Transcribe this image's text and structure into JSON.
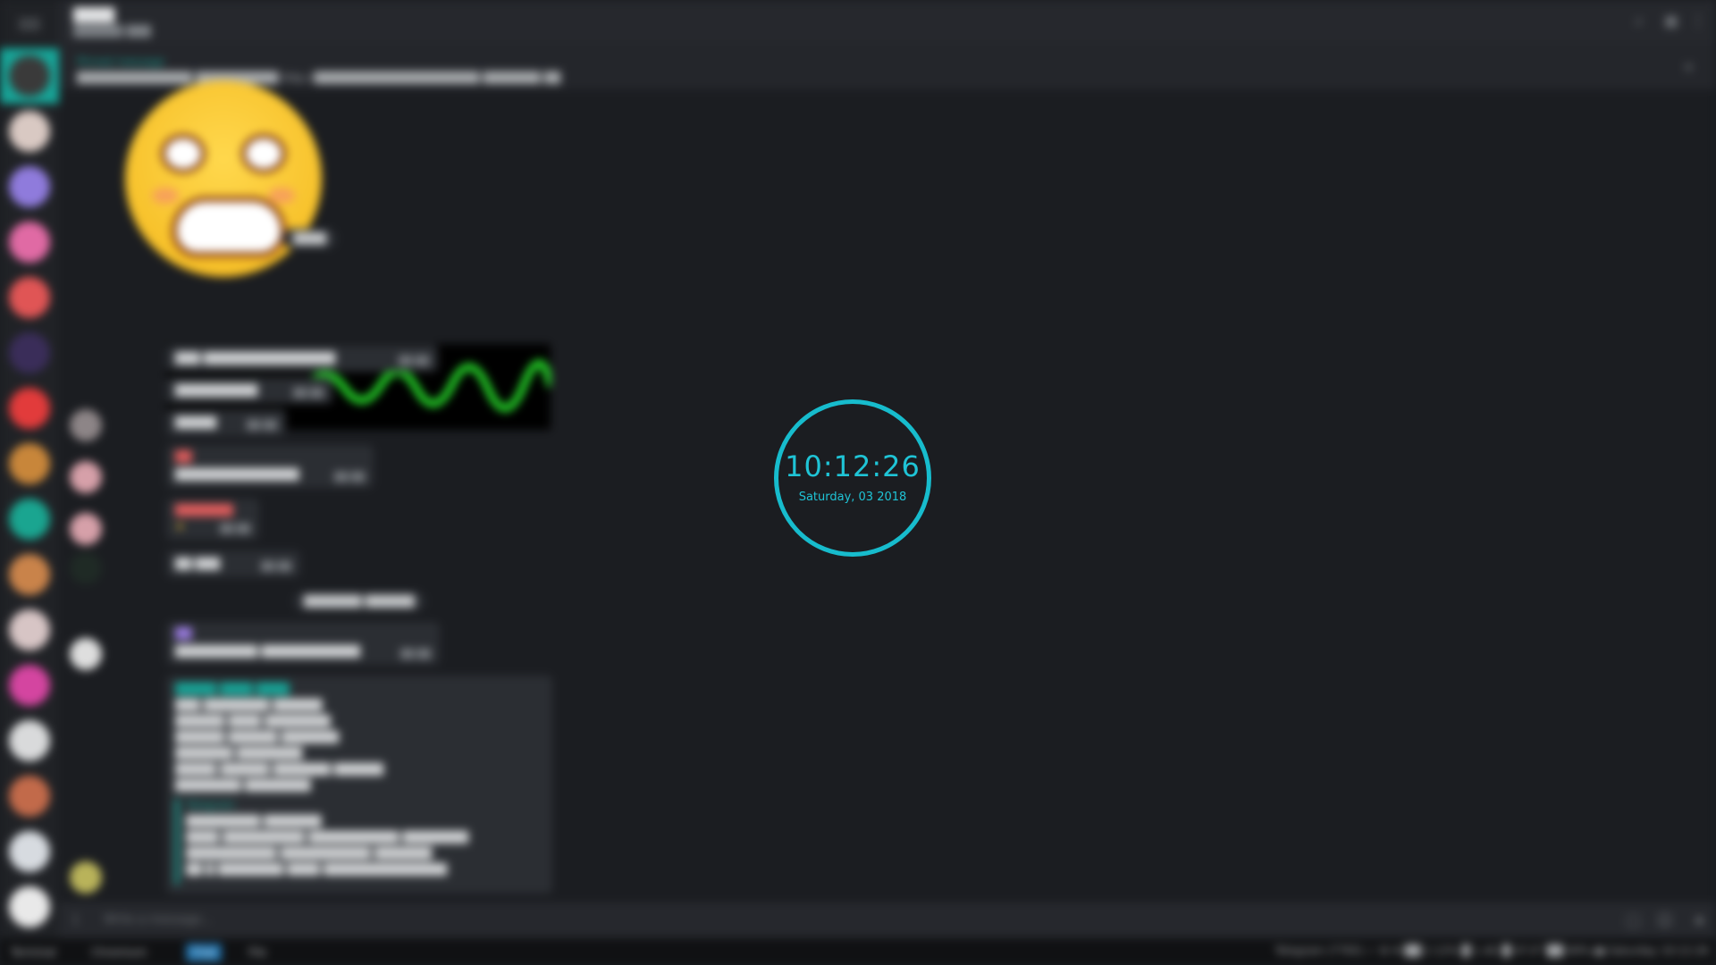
{
  "clock": {
    "time": "10:12:26",
    "date": "Saturday, 03 2018",
    "color": "#1fc4d6"
  },
  "header": {
    "title": "████",
    "subtitle": "██████ ███",
    "icons": [
      "search-icon",
      "columns-icon",
      "more-vert-icon"
    ]
  },
  "pinned": {
    "label": "Pinned message",
    "text": "██████████████   ██████████   http://████████████████████ ███████ ██"
  },
  "sidebar": {
    "icons": [
      "menu-icon"
    ],
    "avatars": [
      {
        "color": "#3a3a3a",
        "active": true
      },
      {
        "color": "#d9c9c3"
      },
      {
        "color": "#8f7bdc"
      },
      {
        "color": "#e06aa4"
      },
      {
        "color": "#e05555"
      },
      {
        "color": "#3a2d59"
      },
      {
        "color": "#e23b3b"
      },
      {
        "color": "#c8863a"
      },
      {
        "color": "#1aa590"
      },
      {
        "color": "#c9834a"
      },
      {
        "color": "#d7c5c5"
      },
      {
        "color": "#d445a0"
      },
      {
        "color": "#d9dadb"
      },
      {
        "color": "#c26a4a"
      },
      {
        "color": "#d7dbe0"
      },
      {
        "color": "#e9e9e9"
      }
    ]
  },
  "messages": {
    "sticker_caption": "████",
    "service_message": "███████ ██████",
    "bubbles": [
      {
        "text": "███ ████████████████",
        "time": "██ ██"
      },
      {
        "text": "██████████",
        "time": "██ ██"
      },
      {
        "text": "█████",
        "time": "██ ██"
      },
      {
        "author": "██",
        "text": "███████████████",
        "time": "██ ██"
      },
      {
        "author": "███████",
        "text": "★",
        "time": "██ ██"
      },
      {
        "text": "██ ███",
        "time": "██ ██"
      },
      {
        "author": "██",
        "text": "██████████ ████████████",
        "time": "██ ██"
      }
    ],
    "forward": {
      "title": "█████ ████ ████",
      "lines": [
        "███ ████████ ██████",
        "██████ ████ ████████",
        "██████ ██████ ███████",
        "███████ ████████",
        "█████ ██████ ███████ ██████",
        "████████   ████████"
      ],
      "quote_title": "Telegram",
      "quote_lines": [
        "█████████ ███████",
        "████ ██████████ ███████████ ████████",
        "███████████ ███████████ ███████",
        "██ █ ████████ ████ ███████████████"
      ]
    }
  },
  "input": {
    "placeholder": "Write a message..."
  },
  "taskbar": {
    "items": [
      "Terminal",
      "Chromium",
      "Chat",
      "File"
    ],
    "tray": "Telegram (7765)  ✓  ⚙  ✉  ██ 2.12%  █ 1.4G  █ 47.0°  ██ 69%  ▮▮  Saturday 10:12:26"
  }
}
